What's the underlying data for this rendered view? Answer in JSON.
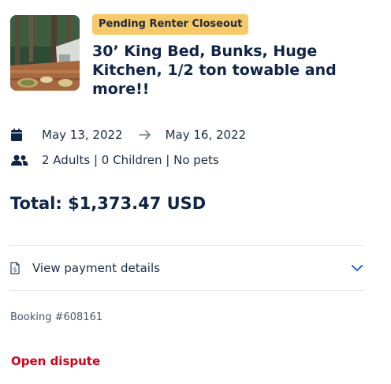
{
  "listing": {
    "status_badge": "Pending Renter Closeout",
    "title": "30’ King Bed, Bunks, Huge Kitchen, 1/2 ton towable and more!!"
  },
  "trip": {
    "start_date": "May 13, 2022",
    "end_date": "May 16, 2022",
    "guests": "2 Adults | 0 Children | No pets"
  },
  "total": "Total: $1,373.47 USD",
  "payment": {
    "details_label": "View payment details"
  },
  "booking": "Booking #608161",
  "actions": {
    "dispute_label": "Open dispute"
  },
  "icons": {
    "calendar": "calendar-icon",
    "arrow": "arrow-right-icon",
    "guests": "users-icon",
    "receipt": "receipt-icon",
    "chevron": "chevron-down-icon"
  },
  "colors": {
    "badge": "#f6c96a",
    "navy": "#0f2446",
    "accent_blue": "#1f6fd1",
    "danger": "#d0021b"
  }
}
